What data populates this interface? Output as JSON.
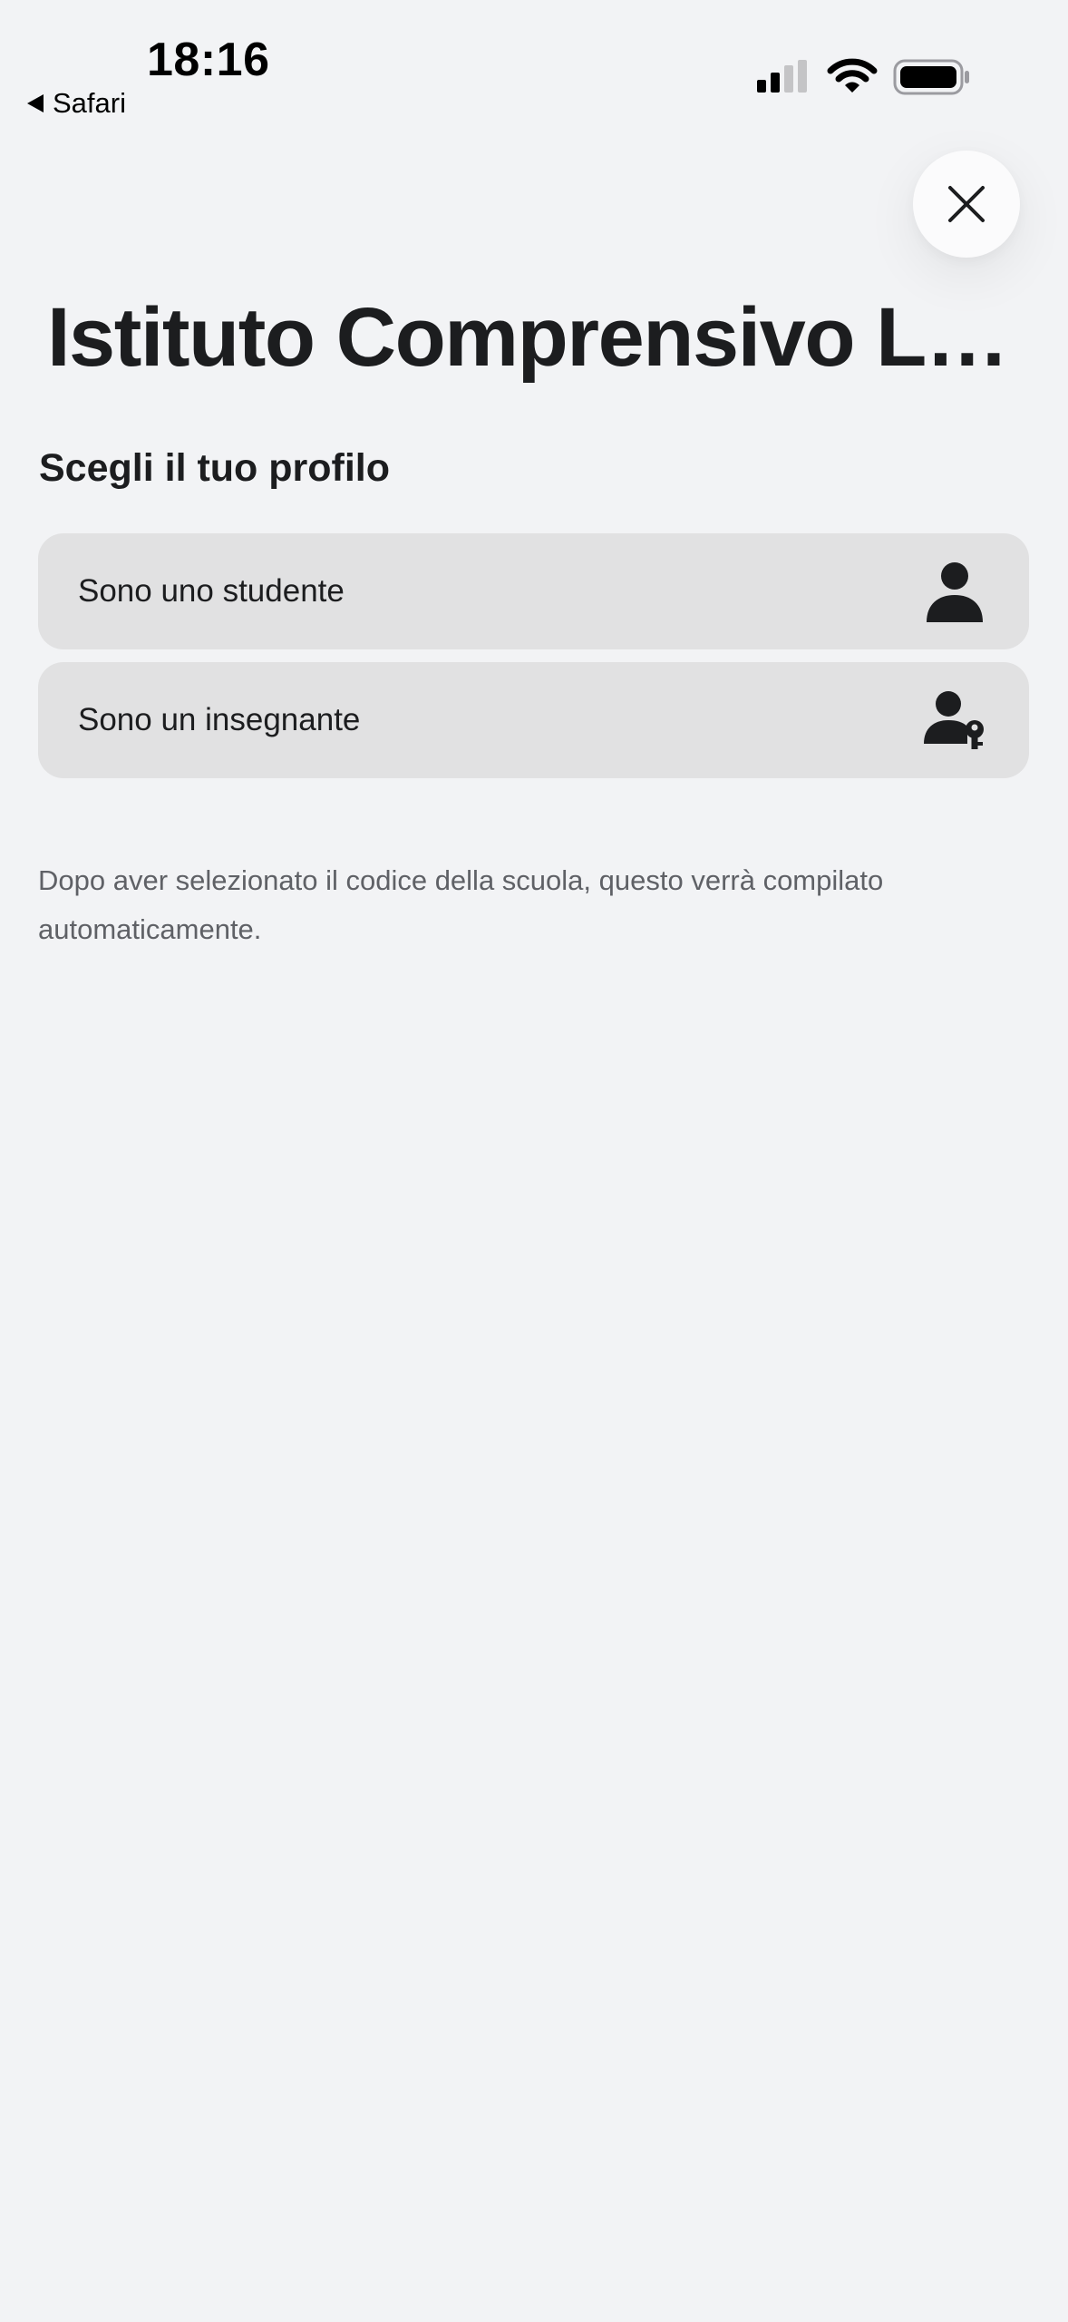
{
  "status_bar": {
    "time": "18:16",
    "back_label": "Safari",
    "icons": [
      "cellular-signal-icon",
      "wifi-icon",
      "battery-icon"
    ]
  },
  "header": {
    "close_icon": "close-icon",
    "title": "Istituto Comprensivo Le..."
  },
  "profile": {
    "section_title": "Scegli il tuo profilo",
    "options": [
      {
        "label": "Sono uno studente",
        "icon": "user-icon"
      },
      {
        "label": "Sono un insegnante",
        "icon": "user-key-icon"
      }
    ]
  },
  "note": "Dopo aver selezionato il codice della scuola, questo verrà compilato automaticamente.",
  "colors": {
    "background": "#f2f3f5",
    "option_background": "#e1e1e2",
    "text": "#1c1d1f",
    "muted_text": "#5f6166"
  }
}
